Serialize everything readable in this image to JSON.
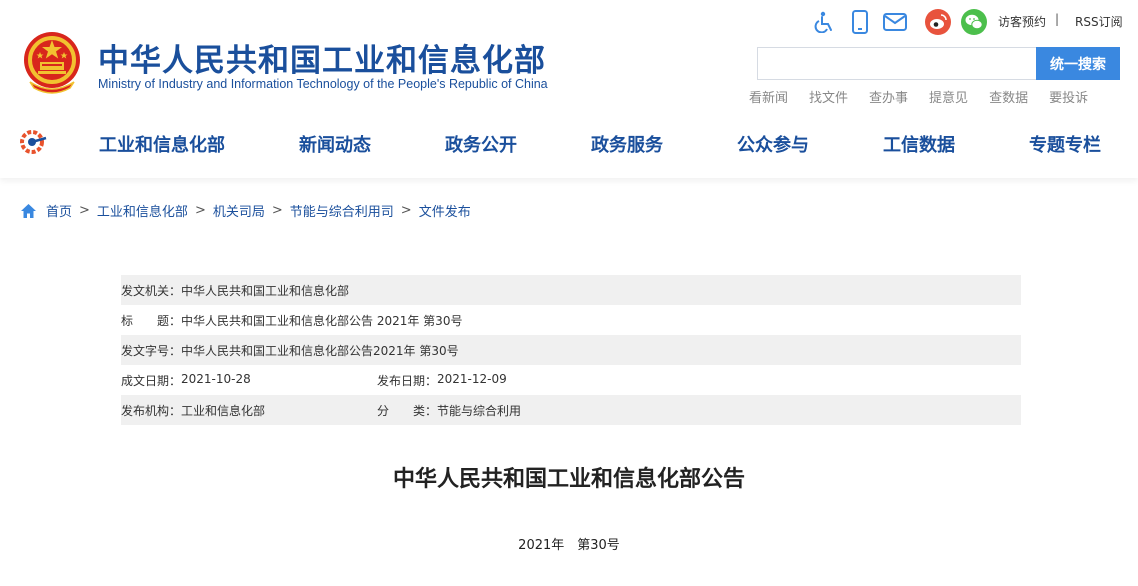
{
  "header": {
    "title": "中华人民共和国工业和信息化部",
    "subtitle": "Ministry of Industry and Information Technology of the People's Republic of China",
    "visitor_booking": "访客预约",
    "separator": "|",
    "rss": "RSS订阅",
    "search": {
      "placeholder": "",
      "button_label": "统一搜索"
    },
    "quick_links": [
      "看新闻",
      "找文件",
      "查办事",
      "提意见",
      "查数据",
      "要投诉"
    ],
    "icons": [
      "accessibility-icon",
      "mobile-icon",
      "mail-icon",
      "weibo-icon",
      "wechat-icon"
    ]
  },
  "nav": {
    "items": [
      "工业和信息化部",
      "新闻动态",
      "政务公开",
      "政务服务",
      "公众参与",
      "工信数据",
      "专题专栏"
    ]
  },
  "breadcrumb": {
    "items": [
      "首页",
      "工业和信息化部",
      "机关司局",
      "节能与综合利用司",
      "文件发布"
    ],
    "separator": ">"
  },
  "info": {
    "issuer_label": "发文机关：",
    "issuer": "中华人民共和国工业和信息化部",
    "title_label": "标　　题：",
    "title": "中华人民共和国工业和信息化部公告 2021年 第30号",
    "doc_no_label": "发文字号：",
    "doc_no": "中华人民共和国工业和信息化部公告2021年 第30号",
    "created_label": "成文日期：",
    "created": "2021-10-28",
    "published_label": "发布日期：",
    "published": "2021-12-09",
    "org_label": "发布机构：",
    "org": "工业和信息化部",
    "category_label": "分　　类：",
    "category": "节能与综合利用"
  },
  "article": {
    "title": "中华人民共和国工业和信息化部公告",
    "number": "2021年　第30号"
  },
  "colors": {
    "brand_blue": "#1a4f9c",
    "search_button": "#3a88e0",
    "row_shade": "#f0f0f0"
  }
}
